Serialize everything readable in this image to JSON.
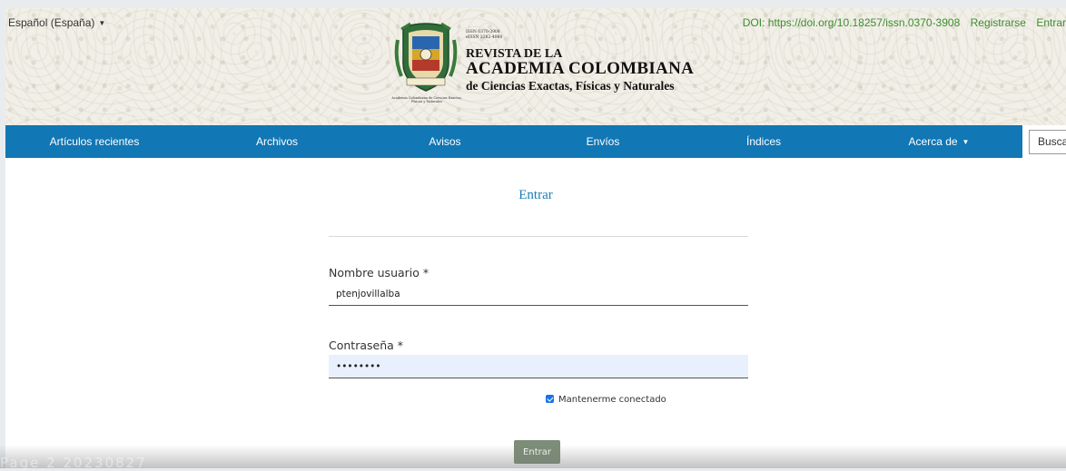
{
  "header": {
    "language_selector": "Español (España)",
    "user_links": {
      "doi": "DOI: https://doi.org/10.18257/issn.0370-3908",
      "register": "Registrarse",
      "login": "Entrar"
    },
    "logo": {
      "issn_print": "ISSN 0370-3908",
      "issn_online": "eISSN 2382-4980",
      "title_line1": "REVISTA DE LA",
      "title_line2": "ACADEMIA COLOMBIANA",
      "title_line3": "de Ciencias Exactas, Físicas y Naturales",
      "crest_caption": "Academia Colombiana de Ciencias Exactas, Físicas y Naturales"
    }
  },
  "nav": {
    "items": [
      {
        "label": "Artículos recientes"
      },
      {
        "label": "Archivos"
      },
      {
        "label": "Avisos"
      },
      {
        "label": "Envíos"
      },
      {
        "label": "Índices"
      },
      {
        "label": "Acerca de"
      }
    ],
    "search_label": "Buscar"
  },
  "login_form": {
    "heading": "Entrar",
    "username_label": "Nombre usuario *",
    "username_value": "ptenjovillalba",
    "password_label": "Contraseña *",
    "password_value": "••••••••",
    "remember_label": "Mantenerme conectado",
    "remember_checked": true,
    "submit_label": "Entrar"
  },
  "overlay": {
    "watermark": "Page 2 20230827"
  },
  "colors": {
    "nav_bg": "#1177b5",
    "link_green": "#3b8e2f",
    "heading_blue": "#1a7fb5",
    "submit_bg": "#7c8e77",
    "password_bg": "#e8f0fe"
  }
}
